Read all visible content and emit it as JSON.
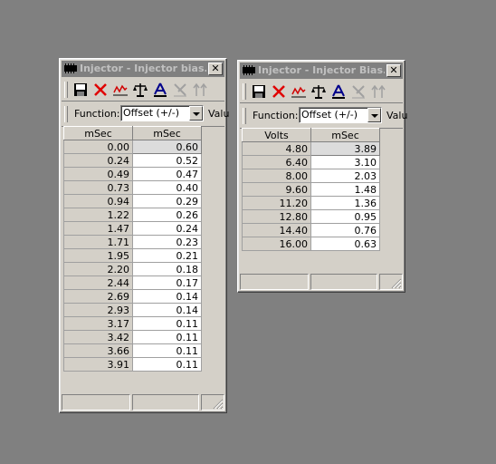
{
  "windows": [
    {
      "title": "Injector - Injector bias...",
      "close_glyph": "✕",
      "function_label": "Function:",
      "function_value": "Offset (+/-)",
      "value_label": "Valu",
      "headers": [
        "mSec",
        "mSec"
      ],
      "rows": [
        [
          "0.00",
          "0.60"
        ],
        [
          "0.24",
          "0.52"
        ],
        [
          "0.49",
          "0.47"
        ],
        [
          "0.73",
          "0.40"
        ],
        [
          "0.94",
          "0.29"
        ],
        [
          "1.22",
          "0.26"
        ],
        [
          "1.47",
          "0.24"
        ],
        [
          "1.71",
          "0.23"
        ],
        [
          "1.95",
          "0.21"
        ],
        [
          "2.20",
          "0.18"
        ],
        [
          "2.44",
          "0.17"
        ],
        [
          "2.69",
          "0.14"
        ],
        [
          "2.93",
          "0.14"
        ],
        [
          "3.17",
          "0.11"
        ],
        [
          "3.42",
          "0.11"
        ],
        [
          "3.66",
          "0.11"
        ],
        [
          "3.91",
          "0.11"
        ]
      ]
    },
    {
      "title": "Injector - Injector Bias...",
      "close_glyph": "✕",
      "function_label": "Function:",
      "function_value": "Offset (+/-)",
      "value_label": "Valu",
      "headers": [
        "Volts",
        "mSec"
      ],
      "rows": [
        [
          "4.80",
          "3.89"
        ],
        [
          "6.40",
          "3.10"
        ],
        [
          "8.00",
          "2.03"
        ],
        [
          "9.60",
          "1.48"
        ],
        [
          "11.20",
          "1.36"
        ],
        [
          "12.80",
          "0.95"
        ],
        [
          "14.40",
          "0.76"
        ],
        [
          "16.00",
          "0.63"
        ]
      ]
    }
  ],
  "toolbar_icons": [
    "save-icon",
    "delete-x-icon",
    "graph-icon",
    "scale-balance-icon",
    "triangle-a-icon",
    "tools-icon",
    "arrows-icon"
  ],
  "colors": {
    "desktop": "#808080",
    "window": "#d4d0c8",
    "inactive_title": "#808080",
    "inactive_title_text": "#c0c0c0"
  }
}
